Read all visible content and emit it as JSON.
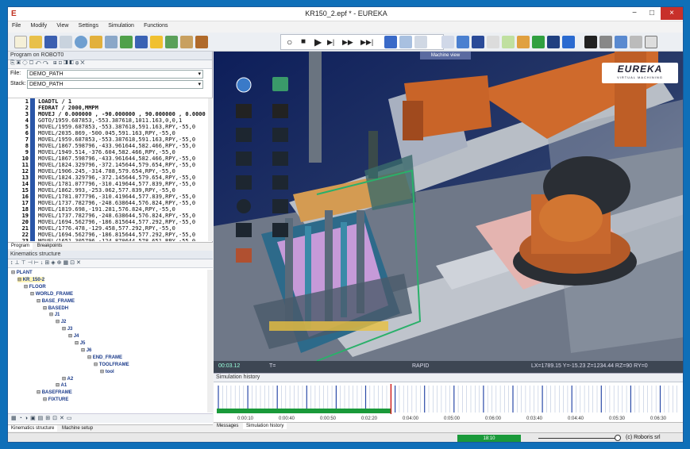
{
  "window": {
    "title": "KR150_2.epf * - EUREKA",
    "icon": "eureka-app-icon",
    "controls": [
      "−",
      "□",
      "×"
    ]
  },
  "menu": [
    "File",
    "Modify",
    "View",
    "Settings",
    "Simulation",
    "Functions"
  ],
  "toolbar": {
    "left_icons": [
      "new-file-icon",
      "open-folder-icon",
      "save-icon",
      "cut-icon",
      "zoom-icon",
      "material-icon",
      "stack-icon",
      "import-icon",
      "paint-icon",
      "properties-icon",
      "layer-icon",
      "tools-icon",
      "pointer-icon"
    ],
    "sim_controls": [
      "○",
      "■",
      "▶",
      "▶|",
      "▶▶",
      "▶▶|"
    ],
    "right_icons": [
      "program-icon",
      "ruler-icon",
      "measure-icon",
      "grid-icon",
      "sort-icon",
      "palette-icon",
      "collision-icon",
      "move-icon",
      "monitor-icon",
      "camera-icon",
      "projector-icon",
      "settings-icon",
      "chart-icon",
      "triangle-icon"
    ]
  },
  "program_panel": {
    "title": "Program on ROBOT0",
    "file_label": "File:",
    "file_value": "DEMO_PATH",
    "stack_label": "Stack:",
    "stack_value": "DEMO_PATH"
  },
  "code_lines": [
    {
      "n": "1",
      "t": "LOADTL / 1"
    },
    {
      "n": "2",
      "t": "FEDRAT / 2000,MMPM"
    },
    {
      "n": "3",
      "t": "MOVEJ / 0.000000 , -90.000000 , 90.000000 , 0.0000"
    },
    {
      "n": "4",
      "t": "GOTO/1959.687853,-553.387618,1011.163,0,0,1"
    },
    {
      "n": "5",
      "t": "MOVEL/1959.687853,-553.387618,591.163,RPY,-55,0"
    },
    {
      "n": "6",
      "t": "MOVEL/2035.869,-500.045,591.163,RPY,-55,0"
    },
    {
      "n": "7",
      "t": "MOVEL/1959.687853,-553.387618,591.163,RPY,-55,0"
    },
    {
      "n": "8",
      "t": "MOVEL/1867.598796,-433.961644,582.466,RPY,-55,0"
    },
    {
      "n": "9",
      "t": "MOVEL/1949.514,-376.604,582.466,RPY,-55,0"
    },
    {
      "n": "10",
      "t": "MOVEL/1867.598796,-433.961644,582.466,RPY,-55,0"
    },
    {
      "n": "11",
      "t": "MOVEL/1824.329796,-372.145644,579.654,RPY,-55,0"
    },
    {
      "n": "12",
      "t": "MOVEL/1906.245,-314.788,579.654,RPY,-55,0"
    },
    {
      "n": "13",
      "t": "MOVEL/1824.329796,-372.145644,579.654,RPY,-55,0"
    },
    {
      "n": "14",
      "t": "MOVEL/1781.077796,-310.419644,577.839,RPY,-55,0"
    },
    {
      "n": "15",
      "t": "MOVEL/1862.993,-253.062,577.839,RPY,-55,0"
    },
    {
      "n": "16",
      "t": "MOVEL/1781.077796,-310.419644,577.839,RPY,-55,0"
    },
    {
      "n": "17",
      "t": "MOVEL/1737.782796,-248.638644,576.824,RPY,-55,0"
    },
    {
      "n": "18",
      "t": "MOVEL/1819.698,-191.281,576.824,RPY,-55,0"
    },
    {
      "n": "19",
      "t": "MOVEL/1737.782796,-248.638644,576.824,RPY,-55,0"
    },
    {
      "n": "20",
      "t": "MOVEL/1694.562796,-186.815644,577.292,RPY,-55,0"
    },
    {
      "n": "21",
      "t": "MOVEL/1776.478,-129.458,577.292,RPY,-55,0"
    },
    {
      "n": "22",
      "t": "MOVEL/1694.562796,-186.815644,577.292,RPY,-55,0"
    },
    {
      "n": "23",
      "t": "MOVEL/1651.305796,-124.870644,578.651,RPY,-55,0"
    }
  ],
  "program_tabs": [
    "Program",
    "Breakpoints"
  ],
  "kinematics": {
    "title": "Kinematics structure"
  },
  "tree": [
    {
      "label": "PLANT",
      "d": 0
    },
    {
      "label": "KR_150-2",
      "d": 1
    },
    {
      "label": "FLOOR",
      "d": 2
    },
    {
      "label": "WORLD_FRAME",
      "d": 3
    },
    {
      "label": "BASE_FRAME",
      "d": 4
    },
    {
      "label": "BASEDH",
      "d": 5
    },
    {
      "label": "J1",
      "d": 6
    },
    {
      "label": "J2",
      "d": 7
    },
    {
      "label": "J3",
      "d": 8
    },
    {
      "label": "J4",
      "d": 9
    },
    {
      "label": "J5",
      "d": 10
    },
    {
      "label": "J6",
      "d": 11
    },
    {
      "label": "END_FRAME",
      "d": 12
    },
    {
      "label": "TOOLFRAME",
      "d": 13
    },
    {
      "label": "tool",
      "d": 14
    },
    {
      "label": "A2",
      "d": 8
    },
    {
      "label": "A1",
      "d": 7
    },
    {
      "label": "BASEFRAME",
      "d": 4
    },
    {
      "label": "FIXTURE",
      "d": 5
    }
  ],
  "left_tabs": [
    "Kinematics structure",
    "Machine setup"
  ],
  "viewport": {
    "label": "Machine view",
    "brand": "EUREKA",
    "brand_sub": "VIRTUAL MACHINING",
    "time": "00:03.12",
    "t_label": "T=",
    "mode": "RAPID",
    "coords": "LX=1789.15 Y=-15.23 Z=1234.44 RZ=90 RY=0"
  },
  "sim": {
    "title": "Simulation history",
    "ticks": [
      "0:00:10",
      "0:00:40",
      "0:00:50",
      "0:02:20",
      "0:04:00",
      "0:05:00",
      "0:06:00",
      "0:03:40",
      "0:04:40",
      "0:05:30",
      "0:06:30"
    ],
    "progress": 0.57
  },
  "bottom_tabs": [
    "Messages",
    "Simulation history"
  ],
  "status": {
    "progress_text": "18:10",
    "copyright": "(c) Roboris srl"
  },
  "colors": {
    "robot": "#d0672e",
    "frame_blue": "#1e4fa8",
    "sim_green": "#1a9a3a",
    "title_blue": "#0f6fb8"
  }
}
